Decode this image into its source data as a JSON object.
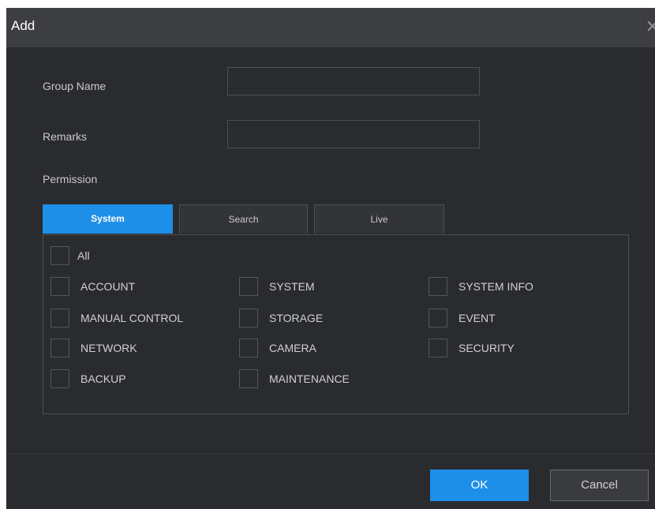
{
  "dialog": {
    "title": "Add",
    "close_glyph": "✕"
  },
  "form": {
    "group_name_label": "Group Name",
    "group_name_value": "",
    "remarks_label": "Remarks",
    "remarks_value": "",
    "permission_label": "Permission"
  },
  "tabs": [
    {
      "label": "System",
      "active": true
    },
    {
      "label": "Search",
      "active": false
    },
    {
      "label": "Live",
      "active": false
    }
  ],
  "permissions": {
    "all_label": "All",
    "items": [
      "ACCOUNT",
      "SYSTEM",
      "SYSTEM INFO",
      "MANUAL CONTROL",
      "STORAGE",
      "EVENT",
      "NETWORK",
      "CAMERA",
      "SECURITY",
      "BACKUP",
      "MAINTENANCE"
    ]
  },
  "footer": {
    "ok_label": "OK",
    "cancel_label": "Cancel"
  },
  "colors": {
    "accent": "#1e8fe9",
    "background": "#2a2b2f",
    "titlebar": "#3d3e42"
  }
}
